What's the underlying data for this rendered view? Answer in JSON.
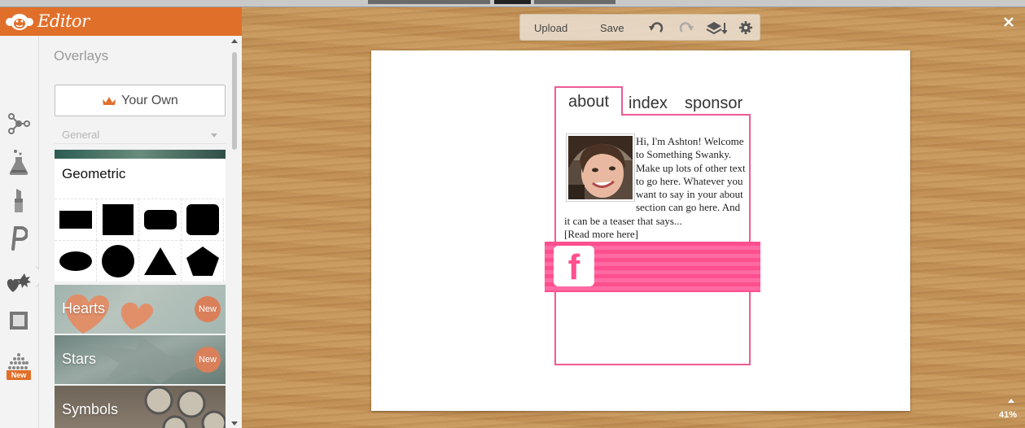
{
  "app": {
    "brand_name": "Editor"
  },
  "colors": {
    "accent": "#e06f2a",
    "pink": "#ef5b94",
    "stripe": "#ff4f8f",
    "badge": "#d9805a"
  },
  "icon_rail": [
    {
      "name": "edit-nodes-icon"
    },
    {
      "name": "effects-flask-icon"
    },
    {
      "name": "touch-up-lipstick-icon"
    },
    {
      "name": "text-p-icon"
    },
    {
      "name": "overlays-icon"
    },
    {
      "name": "frames-icon"
    },
    {
      "name": "textures-icon",
      "badge": "New"
    }
  ],
  "panel": {
    "title": "Overlays",
    "your_own_label": "Your Own",
    "category_select": "General",
    "geometric": {
      "title": "Geometric",
      "shapes": [
        "rectangle-wide",
        "square",
        "rounded-rectangle",
        "rounded-square",
        "ellipse",
        "circle",
        "triangle",
        "pentagon"
      ]
    },
    "cards": [
      {
        "label": "Hearts",
        "badge": "New"
      },
      {
        "label": "Stars",
        "badge": "New"
      },
      {
        "label": "Symbols"
      }
    ]
  },
  "toolbar": {
    "upload_label": "Upload",
    "save_label": "Save",
    "icons": [
      "undo-icon",
      "redo-icon",
      "layers-icon",
      "settings-gear-icon"
    ]
  },
  "zoom": {
    "level": "41%"
  },
  "canvas": {
    "tabs": [
      "about",
      "index",
      "sponsor"
    ],
    "about_text": "Hi, I'm Ashton! Welcome to Something Swanky. Make up lots of other text to go here. Whatever you want to say in your about section can go here. And it can be a teaser that says...",
    "read_more": "[Read more here]",
    "social_glyph": "f"
  }
}
